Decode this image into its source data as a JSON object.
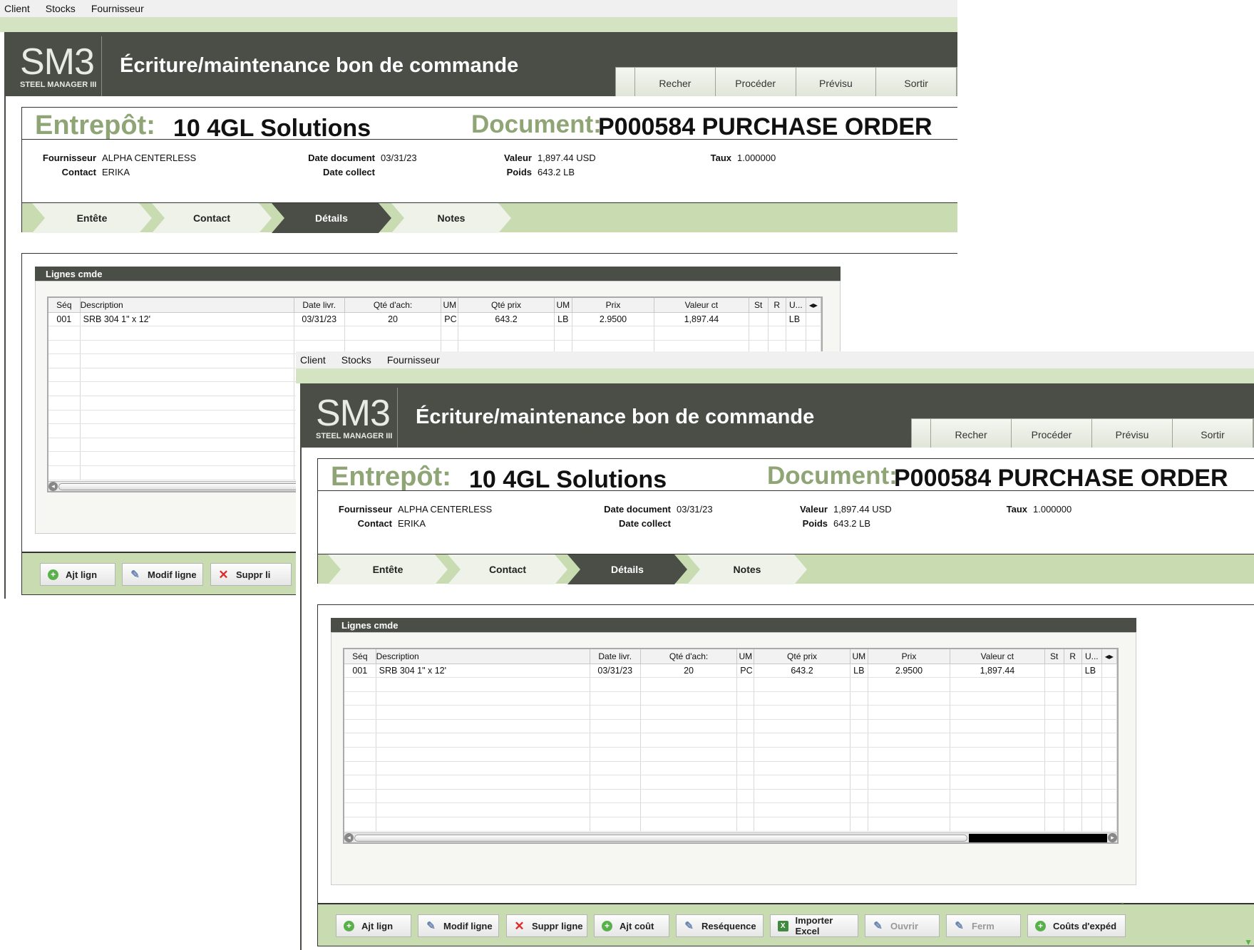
{
  "menu": [
    "Client",
    "Stocks",
    "Fournisseur"
  ],
  "logo": {
    "main": "SM3",
    "sub": "STEEL MANAGER III"
  },
  "title": "Écriture/maintenance bon de commande",
  "toolbar": [
    "Recher",
    "Procéder",
    "Prévisu",
    "Sortir"
  ],
  "header": {
    "entrepot_label": "Entrepôt:",
    "entrepot_value": "10 4GL Solutions",
    "document_label": "Document:",
    "document_value": "P000584 PURCHASE ORDER"
  },
  "fields": {
    "fournisseur_label": "Fournisseur",
    "fournisseur": "ALPHA CENTERLESS",
    "contact_label": "Contact",
    "contact": "ERIKA",
    "date_doc_label": "Date document",
    "date_doc": "03/31/23",
    "date_collect_label": "Date collect",
    "date_collect": "",
    "valeur_label": "Valeur",
    "valeur": "1,897.44 USD",
    "poids_label": "Poids",
    "poids": "643.2 LB",
    "taux_label": "Taux",
    "taux": "1.000000"
  },
  "tabs": [
    "Entête",
    "Contact",
    "Détails",
    "Notes"
  ],
  "active_tab": "Détails",
  "lines": {
    "title": "Lignes cmde",
    "columns": [
      "Séq",
      "Description",
      "Date livr.",
      "Qté d'ach:",
      "UM",
      "Qté prix",
      "UM",
      "Prix",
      "Valeur ct",
      "St",
      "R",
      "U..."
    ],
    "rows": [
      [
        "001",
        "SRB 304 1\" x 12'",
        "03/31/23",
        "20",
        "PC",
        "643.2",
        "LB",
        "2.9500",
        "1,897.44",
        "",
        "",
        "LB"
      ]
    ]
  },
  "actions": [
    "Ajt lign",
    "Modif ligne",
    "Suppr ligne",
    "Ajt coût",
    "Reséquence",
    "Importer Excel",
    "Ouvrir",
    "Ferm",
    "Coûts d'expéd"
  ],
  "actions_partial": [
    "Ajt lign",
    "Modif ligne",
    "Suppr li"
  ]
}
